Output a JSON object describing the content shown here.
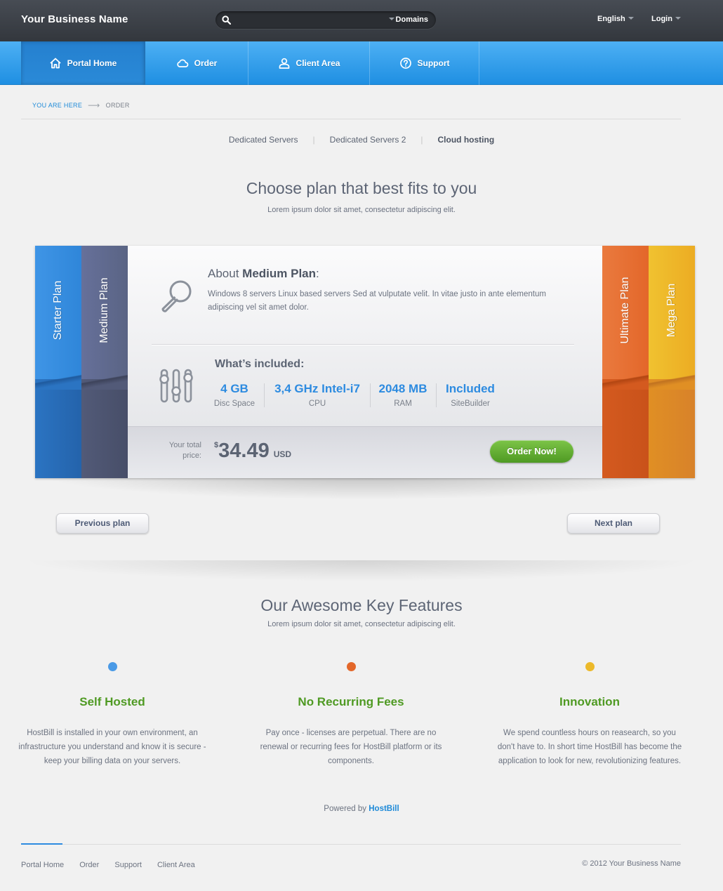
{
  "header": {
    "brand": "Your Business Name",
    "search": {
      "placeholder": "",
      "dropdown": "Domains"
    },
    "language": "English",
    "login": "Login"
  },
  "nav": {
    "items": [
      {
        "label": "Portal Home",
        "icon": "home-icon",
        "active": true
      },
      {
        "label": "Order",
        "icon": "cloud-icon"
      },
      {
        "label": "Client Area",
        "icon": "user-icon"
      },
      {
        "label": "Support",
        "icon": "help-icon"
      }
    ]
  },
  "breadcrumb": {
    "prefix": "YOU ARE HERE",
    "current": "ORDER"
  },
  "subtabs": [
    "Dedicated Servers",
    "Dedicated Servers 2",
    "Cloud hosting"
  ],
  "hero": {
    "title": "Choose plan that best fits to you",
    "subtitle": "Lorem ipsum dolor sit amet, consectetur adipiscing elit."
  },
  "plans": {
    "tabs": [
      {
        "label": "Starter Plan",
        "color": "#2f86d9"
      },
      {
        "label": "Medium Plan",
        "color": "#5a6484"
      },
      {
        "label": "Ultimate Plan",
        "color": "#e3672a"
      },
      {
        "label": "Mega Plan",
        "color": "#ecac23"
      }
    ],
    "about_prefix": "About ",
    "about_name": "Medium Plan",
    "about_suffix": ":",
    "about_text": "Windows 8 servers Linux based servers Sed at vulputate velit. In vitae justo in ante elementum adipiscing vel sit amet dolor.",
    "included_title": "What’s included:",
    "specs": [
      {
        "value": "4 GB",
        "label": "Disc Space"
      },
      {
        "value": "3,4 GHz Intel-i7",
        "label": "CPU"
      },
      {
        "value": "2048 MB",
        "label": "RAM"
      },
      {
        "value": "Included",
        "label": "SiteBuilder"
      }
    ],
    "price_label_1": "Your total",
    "price_label_2": "price:",
    "currency_symbol": "$",
    "price": "34.49",
    "currency": "USD",
    "order_button": "Order Now!"
  },
  "pager": {
    "prev": "Previous plan",
    "next": "Next plan"
  },
  "features": {
    "title": "Our Awesome Key Features",
    "subtitle": "Lorem ipsum dolor sit amet, consectetur adipiscing elit.",
    "items": [
      {
        "title": "Self Hosted",
        "dot_color": "#4a9ae6",
        "text": "HostBill is installed in your own environment, an infrastructure you understand and know it is secure - keep your billing data on your servers."
      },
      {
        "title": "No Recurring Fees",
        "dot_color": "#e3672a",
        "text": "Pay once - licenses are perpetual. There are no renewal or recurring fees for HostBill platform or its components."
      },
      {
        "title": "Innovation",
        "dot_color": "#ecb92a",
        "text": "We spend countless hours on reasearch, so you don't have to. In short time HostBill has become the application to look for new, revolutionizing features."
      }
    ]
  },
  "footer": {
    "powered_prefix": "Powered by",
    "powered_brand": "HostBill",
    "links": [
      "Portal Home",
      "Order",
      "Support",
      "Client Area"
    ],
    "copyright": "© 2012 Your Business Name"
  }
}
